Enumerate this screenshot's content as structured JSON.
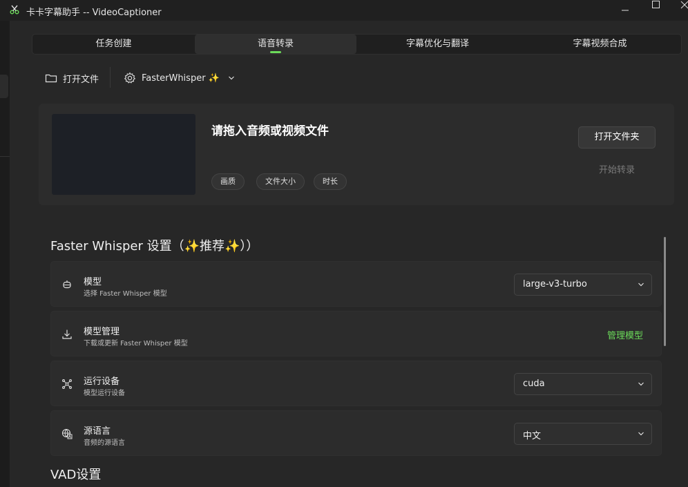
{
  "window": {
    "title": "卡卡字幕助手 -- VideoCaptioner"
  },
  "tabs": [
    {
      "label": "任务创建"
    },
    {
      "label": "语音转录"
    },
    {
      "label": "字幕优化与翻译"
    },
    {
      "label": "字幕视频合成"
    }
  ],
  "toolbar": {
    "open_file": "打开文件",
    "engine": "FasterWhisper ✨"
  },
  "drop_card": {
    "title": "请拖入音频或视频文件",
    "chips": [
      "画质",
      "文件大小",
      "时长"
    ],
    "open_folder": "打开文件夹",
    "start": "开始转录"
  },
  "faster_whisper": {
    "section_title": "Faster Whisper 设置（✨推荐✨））",
    "rows": [
      {
        "title": "模型",
        "desc": "选择 Faster Whisper 模型",
        "value": "large-v3-turbo"
      },
      {
        "title": "模型管理",
        "desc": "下载或更新 Faster Whisper 模型",
        "action": "管理模型"
      },
      {
        "title": "运行设备",
        "desc": "模型运行设备",
        "value": "cuda"
      },
      {
        "title": "源语言",
        "desc": "音频的源语言",
        "value": "中文"
      }
    ]
  },
  "vad": {
    "section_title": "VAD设置"
  },
  "colors": {
    "accent": "#6cdb5a",
    "background": "#272727",
    "card": "#2c2c2c"
  }
}
